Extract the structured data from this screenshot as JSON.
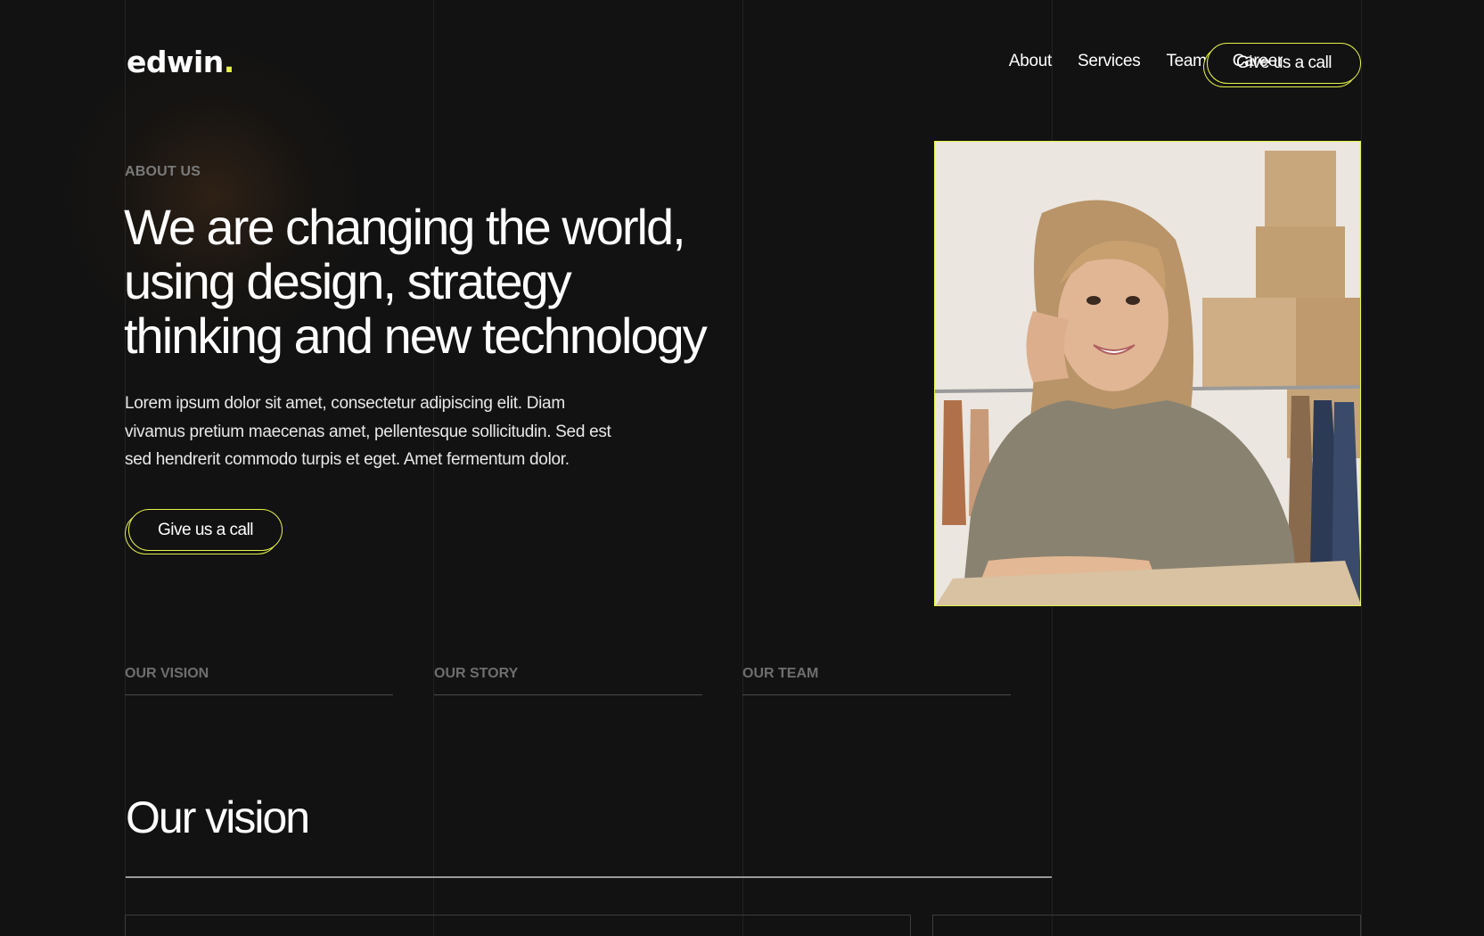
{
  "brand": {
    "name": "edwin",
    "dot": ".",
    "accent": "#e5f24a",
    "background": "#121212"
  },
  "nav": {
    "items": [
      "About",
      "Services",
      "Team",
      "Career"
    ],
    "cta_label": "Give us a call"
  },
  "hero": {
    "eyebrow": "ABOUT US",
    "headline": [
      "We are changing the world,",
      "using design, strategy",
      "thinking and new technology"
    ],
    "body": [
      "Lorem ipsum dolor sit amet, consectetur adipiscing elit. Diam",
      "vivamus pretium maecenas amet, pellentesque sollicitudin. Sed est",
      "sed hendrerit commodo turpis et eget. Amet fermentum dolor."
    ],
    "cta_label": "Give us a call",
    "photo_alt": "smiling-woman-portrait"
  },
  "tabs": [
    "OUR VISION",
    "OUR STORY",
    "OUR TEAM"
  ],
  "section": {
    "title": "Our vision"
  }
}
